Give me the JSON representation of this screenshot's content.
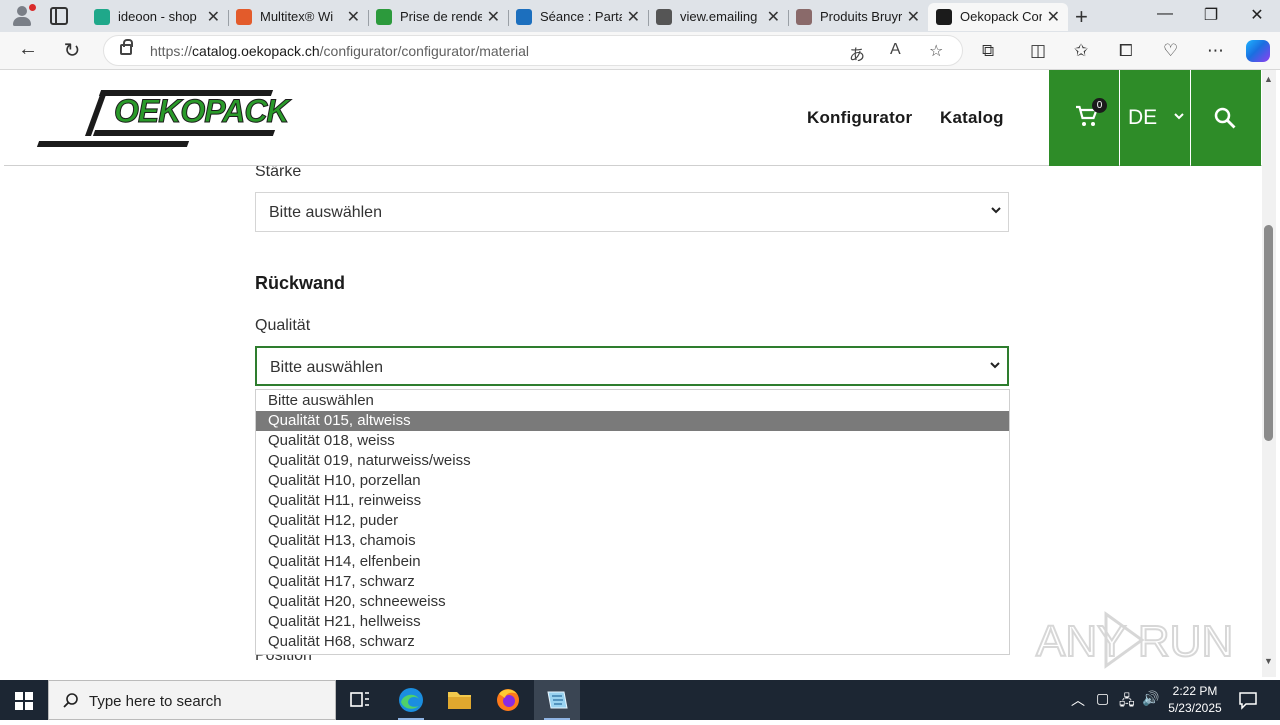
{
  "browser": {
    "tabs": [
      {
        "title": "ideoon - shop",
        "color": "#1fa88a"
      },
      {
        "title": "Multitex® Wi",
        "color": "#e35b2b"
      },
      {
        "title": "Prise de rende",
        "color": "#2c9a3c"
      },
      {
        "title": "Séance : Parta",
        "color": "#1c6fbe"
      },
      {
        "title": "view.emailing",
        "color": "#555555"
      },
      {
        "title": "Produits Bruyr",
        "color": "#8a6a6a"
      },
      {
        "title": "Oekopack Cor",
        "color": "#1b1b1b"
      }
    ],
    "url_prefix": "https://",
    "url_host": "catalog.oekopack.ch",
    "url_path": "/configurator/configurator/material"
  },
  "site": {
    "logo_text": "OEKOPACK",
    "nav": [
      "Konfigurator",
      "Katalog"
    ],
    "cart_count": "0",
    "language": "DE",
    "brand_color": "#2e8c28"
  },
  "form": {
    "staerke_label": "Stärke",
    "staerke_value": "Bitte auswählen",
    "rueckwand_title": "Rückwand",
    "qualitaet_label": "Qualität",
    "qualitaet_value": "Bitte auswählen",
    "position_label": "Position",
    "dropdown_options": [
      "Bitte auswählen",
      "Qualität 015, altweiss",
      "Qualität 018, weiss",
      "Qualität 019, naturweiss/weiss",
      "Qualität H10, porzellan",
      "Qualität H11, reinweiss",
      "Qualität H12, puder",
      "Qualität H13, chamois",
      "Qualität H14, elfenbein",
      "Qualität H17, schwarz",
      "Qualität H20, schneeweiss",
      "Qualität H21, hellweiss",
      "Qualität H68, schwarz"
    ],
    "highlighted_option": "Qualität 015, altweiss"
  },
  "watermark": "ANY RUN",
  "taskbar": {
    "search_placeholder": "Type here to search",
    "time": "2:22 PM",
    "date": "5/23/2025"
  }
}
